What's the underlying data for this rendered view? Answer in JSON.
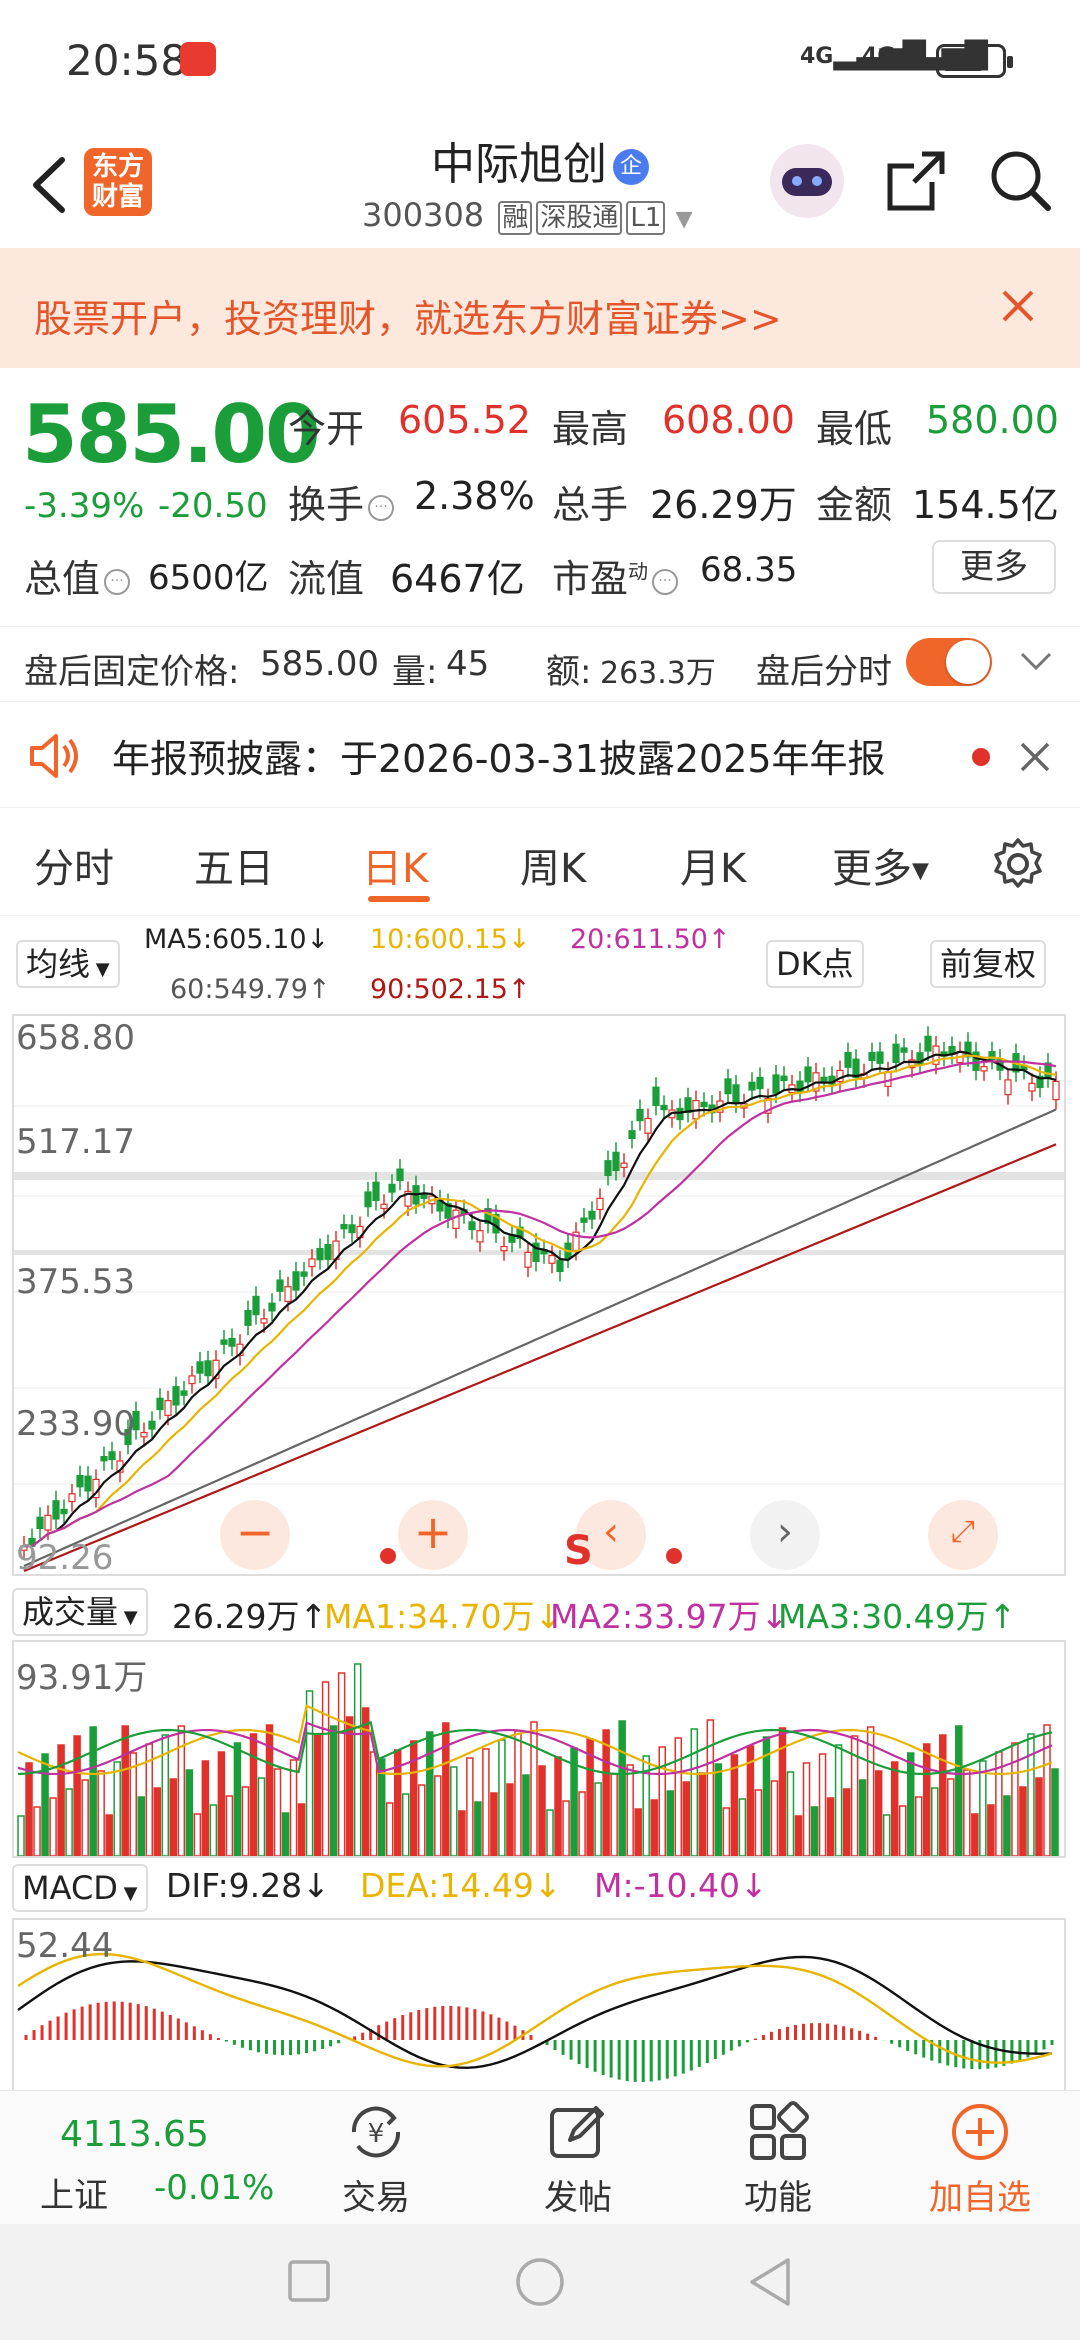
{
  "status_bar": {
    "time": "20:58",
    "signal1": "4G",
    "signal2": "4G"
  },
  "header": {
    "logo_line1": "东方",
    "logo_line2": "财富",
    "stock_name": "中际旭创",
    "badge": "企",
    "code": "300308",
    "tag_rong": "融",
    "tag_sgt": "深股通",
    "tag_l1": "L1"
  },
  "banner": {
    "text": "股票开户，投资理财，就选东方财富证券>>"
  },
  "quote": {
    "price": "585.00",
    "change_pct": "-3.39%",
    "change_amt": "-20.50",
    "open_label": "今开",
    "open": "605.52",
    "high_label": "最高",
    "high": "608.00",
    "low_label": "最低",
    "low": "580.00",
    "turnover_label": "换手",
    "turnover": "2.38%",
    "volume_label": "总手",
    "volume": "26.29万",
    "amount_label": "金额",
    "amount": "154.5亿",
    "mktcap_label": "总值",
    "mktcap": "6500亿",
    "float_label": "流值",
    "float_cap": "6467亿",
    "pe_label": "市盈",
    "pe_sup": "动",
    "pe": "68.35",
    "more_button": "更多"
  },
  "after_hours": {
    "price_label": "盘后固定价格:",
    "price": "585.00",
    "vol_label": "量:",
    "vol": "45",
    "amt_label": "额:",
    "amt": "263.3万",
    "timeshare_label": "盘后分时"
  },
  "notice": {
    "text": "年报预披露：于2026-03-31披露2025年年报"
  },
  "tabs": [
    "分时",
    "五日",
    "日K",
    "周K",
    "月K",
    "更多"
  ],
  "active_tab": "日K",
  "ma_bar": {
    "select": "均线",
    "ma5": "MA5:605.10↓",
    "ma10": "10:600.15↓",
    "ma20": "20:611.50↑",
    "ma60": "60:549.79↑",
    "ma90": "90:502.15↑",
    "dk_button": "DK点",
    "adjust_button": "前复权"
  },
  "kline": {
    "y_labels": [
      "658.80",
      "517.17",
      "375.53",
      "233.90",
      "92.26"
    ],
    "tool_s": "S"
  },
  "volume": {
    "select": "成交量",
    "current": "26.29万↑",
    "ma1": "MA1:34.70万↓",
    "ma2": "MA2:33.97万↓",
    "ma3": "MA3:30.49万↑",
    "max_label": "93.91万"
  },
  "macd": {
    "select": "MACD",
    "dif": "DIF:9.28↓",
    "dea": "DEA:14.49↓",
    "m": "M:-10.40↓",
    "max_label": "52.44"
  },
  "bottom_nav": {
    "index_value": "4113.65",
    "index_name": "上证",
    "index_change": "-0.01%",
    "trade": "交易",
    "post": "发帖",
    "functions": "功能",
    "add_watch": "加自选"
  },
  "colors": {
    "accent": "#f0662a",
    "up": "#e0322b",
    "down": "#1b9e3a"
  }
}
